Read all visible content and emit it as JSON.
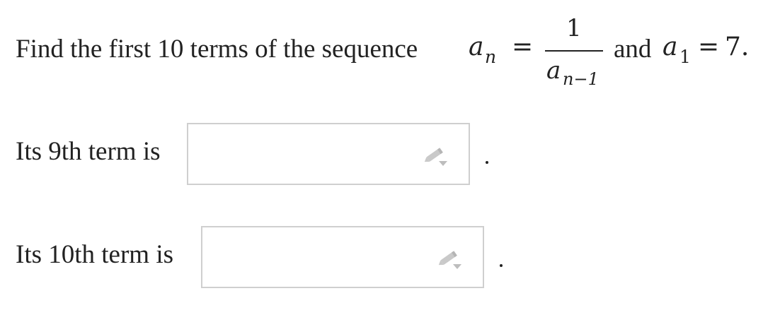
{
  "question": {
    "prefix": "Find the first 10 terms of the sequence",
    "formula": {
      "lhs_var": "a",
      "lhs_sub": "n",
      "equals": "=",
      "numerator": "1",
      "denom_var": "a",
      "denom_sub": "n−1",
      "connector": "and",
      "init_var": "a",
      "init_sub": "1",
      "init_equals": "=",
      "init_value": "7."
    }
  },
  "answers": [
    {
      "label": "Its 9th term is",
      "value": "",
      "icon": "pencil-dropdown-icon",
      "trailing": "."
    },
    {
      "label": "Its 10th term is",
      "value": "",
      "icon": "pencil-dropdown-icon",
      "trailing": "."
    }
  ]
}
